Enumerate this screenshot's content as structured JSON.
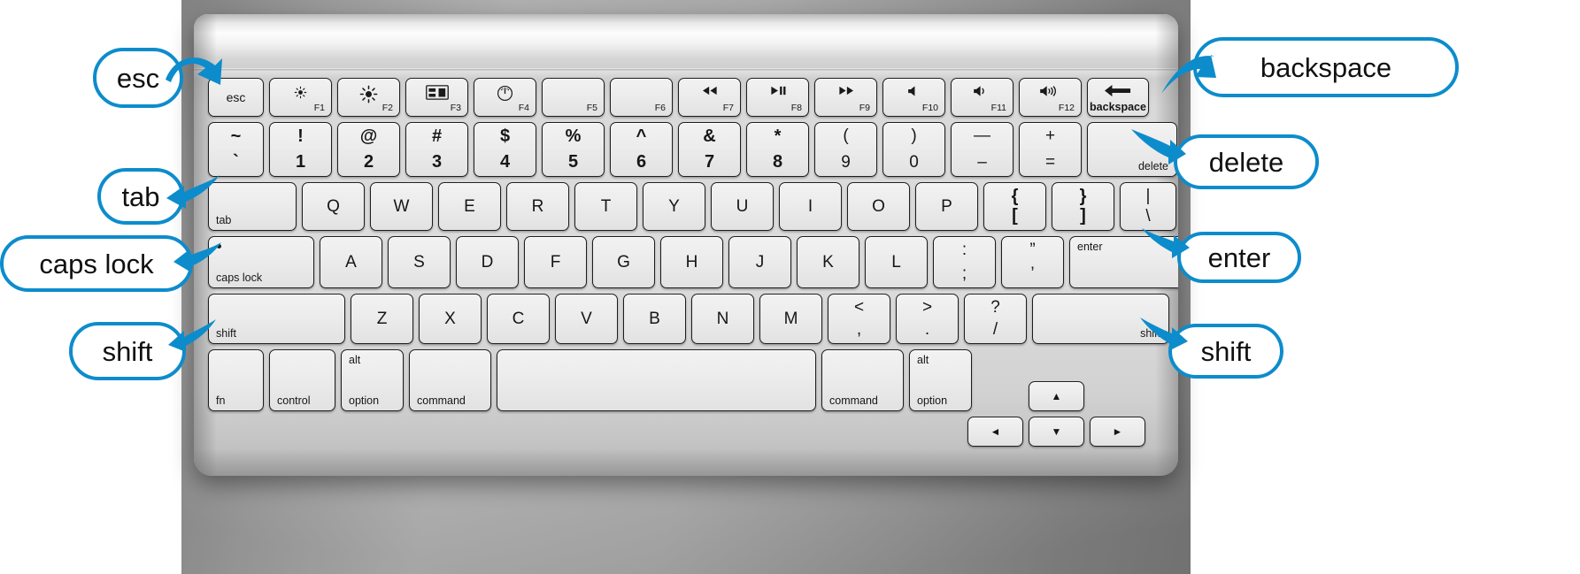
{
  "meta": {
    "subject": "apple-style-wireless-keyboard-diagram",
    "accent_color": "#0d8ccc",
    "key_face_color": "#eaeaea",
    "chassis_color": "#d9d9d9",
    "backdrop_color": "#a8a8a8"
  },
  "callouts": {
    "left": [
      {
        "id": "esc",
        "label": "esc"
      },
      {
        "id": "tab",
        "label": "tab"
      },
      {
        "id": "caps-lock",
        "label": "caps lock"
      },
      {
        "id": "shift-left",
        "label": "shift"
      }
    ],
    "right": [
      {
        "id": "backspace",
        "label": "backspace"
      },
      {
        "id": "delete",
        "label": "delete"
      },
      {
        "id": "enter",
        "label": "enter"
      },
      {
        "id": "shift-right",
        "label": "shift"
      }
    ]
  },
  "keyboard": {
    "function_row": [
      {
        "id": "esc",
        "main": "esc"
      },
      {
        "id": "f1",
        "glyph": "brightness-down-icon",
        "fn": "F1"
      },
      {
        "id": "f2",
        "glyph": "brightness-up-icon",
        "fn": "F2"
      },
      {
        "id": "f3",
        "glyph": "mission-control-icon",
        "fn": "F3"
      },
      {
        "id": "f4",
        "glyph": "dashboard-icon",
        "fn": "F4"
      },
      {
        "id": "f5",
        "glyph": "",
        "fn": "F5"
      },
      {
        "id": "f6",
        "glyph": "",
        "fn": "F6"
      },
      {
        "id": "f7",
        "glyph": "rewind-icon",
        "fn": "F7"
      },
      {
        "id": "f8",
        "glyph": "play-pause-icon",
        "fn": "F8"
      },
      {
        "id": "f9",
        "glyph": "fast-forward-icon",
        "fn": "F9"
      },
      {
        "id": "f10",
        "glyph": "volume-mute-icon",
        "fn": "F10"
      },
      {
        "id": "f11",
        "glyph": "volume-down-icon",
        "fn": "F11"
      },
      {
        "id": "f12",
        "glyph": "volume-up-icon",
        "fn": "F12"
      },
      {
        "id": "backspace",
        "glyph": "arrow-left-icon",
        "fn": "backspace"
      }
    ],
    "number_row": [
      {
        "id": "backtick",
        "upper": "~",
        "lower": "`"
      },
      {
        "id": "one",
        "upper": "!",
        "lower": "1"
      },
      {
        "id": "two",
        "upper": "@",
        "lower": "2"
      },
      {
        "id": "three",
        "upper": "#",
        "lower": "3"
      },
      {
        "id": "four",
        "upper": "$",
        "lower": "4"
      },
      {
        "id": "five",
        "upper": "%",
        "lower": "5"
      },
      {
        "id": "six",
        "upper": "^",
        "lower": "6"
      },
      {
        "id": "seven",
        "upper": "&",
        "lower": "7"
      },
      {
        "id": "eight",
        "upper": "*",
        "lower": "8"
      },
      {
        "id": "nine",
        "upper": "(",
        "lower": "9"
      },
      {
        "id": "zero",
        "upper": ")",
        "lower": "0"
      },
      {
        "id": "minus",
        "upper": "—",
        "lower": "–"
      },
      {
        "id": "equals",
        "upper": "+",
        "lower": "="
      },
      {
        "id": "delete",
        "corner": "delete"
      }
    ],
    "qwerty_row": [
      {
        "id": "tab",
        "corner": "tab"
      },
      {
        "id": "q",
        "letter": "Q"
      },
      {
        "id": "w",
        "letter": "W"
      },
      {
        "id": "e",
        "letter": "E"
      },
      {
        "id": "r",
        "letter": "R"
      },
      {
        "id": "t",
        "letter": "T"
      },
      {
        "id": "y",
        "letter": "Y"
      },
      {
        "id": "u",
        "letter": "U"
      },
      {
        "id": "i",
        "letter": "I"
      },
      {
        "id": "o",
        "letter": "O"
      },
      {
        "id": "p",
        "letter": "P"
      },
      {
        "id": "bracket-left",
        "upper": "{",
        "lower": "["
      },
      {
        "id": "bracket-right",
        "upper": "}",
        "lower": "]"
      },
      {
        "id": "backslash",
        "upper": "|",
        "lower": "\\"
      }
    ],
    "home_row": [
      {
        "id": "caps-lock",
        "corner": "caps lock",
        "indicator": true
      },
      {
        "id": "a",
        "letter": "A"
      },
      {
        "id": "s",
        "letter": "S"
      },
      {
        "id": "d",
        "letter": "D"
      },
      {
        "id": "f",
        "letter": "F"
      },
      {
        "id": "g",
        "letter": "G"
      },
      {
        "id": "h",
        "letter": "H"
      },
      {
        "id": "j",
        "letter": "J"
      },
      {
        "id": "k",
        "letter": "K"
      },
      {
        "id": "l",
        "letter": "L"
      },
      {
        "id": "semicolon",
        "upper": ":",
        "lower": ";"
      },
      {
        "id": "quote",
        "upper": "”",
        "lower": "’"
      },
      {
        "id": "enter",
        "corner": "enter"
      }
    ],
    "shift_row": [
      {
        "id": "shift-left",
        "corner": "shift"
      },
      {
        "id": "z",
        "letter": "Z"
      },
      {
        "id": "x",
        "letter": "X"
      },
      {
        "id": "c",
        "letter": "C"
      },
      {
        "id": "v",
        "letter": "V"
      },
      {
        "id": "b",
        "letter": "B"
      },
      {
        "id": "n",
        "letter": "N"
      },
      {
        "id": "m",
        "letter": "M"
      },
      {
        "id": "comma",
        "upper": "<",
        "lower": ","
      },
      {
        "id": "period",
        "upper": ">",
        "lower": "."
      },
      {
        "id": "slash",
        "upper": "?",
        "lower": "/"
      },
      {
        "id": "shift-right",
        "corner": "shift",
        "corner_side": "right"
      }
    ],
    "modifier_row": [
      {
        "id": "fn",
        "corner": "fn"
      },
      {
        "id": "control",
        "corner": "control"
      },
      {
        "id": "option-left",
        "corner": "option",
        "top": "alt"
      },
      {
        "id": "command-left",
        "corner": "command"
      },
      {
        "id": "space",
        "corner": ""
      },
      {
        "id": "command-right",
        "corner": "command"
      },
      {
        "id": "option-right",
        "corner": "option",
        "top": "alt"
      }
    ],
    "arrow_keys": [
      {
        "id": "arrow-up",
        "glyph": "▲"
      },
      {
        "id": "arrow-left",
        "glyph": "◄"
      },
      {
        "id": "arrow-down",
        "glyph": "▼"
      },
      {
        "id": "arrow-right",
        "glyph": "►"
      }
    ]
  }
}
